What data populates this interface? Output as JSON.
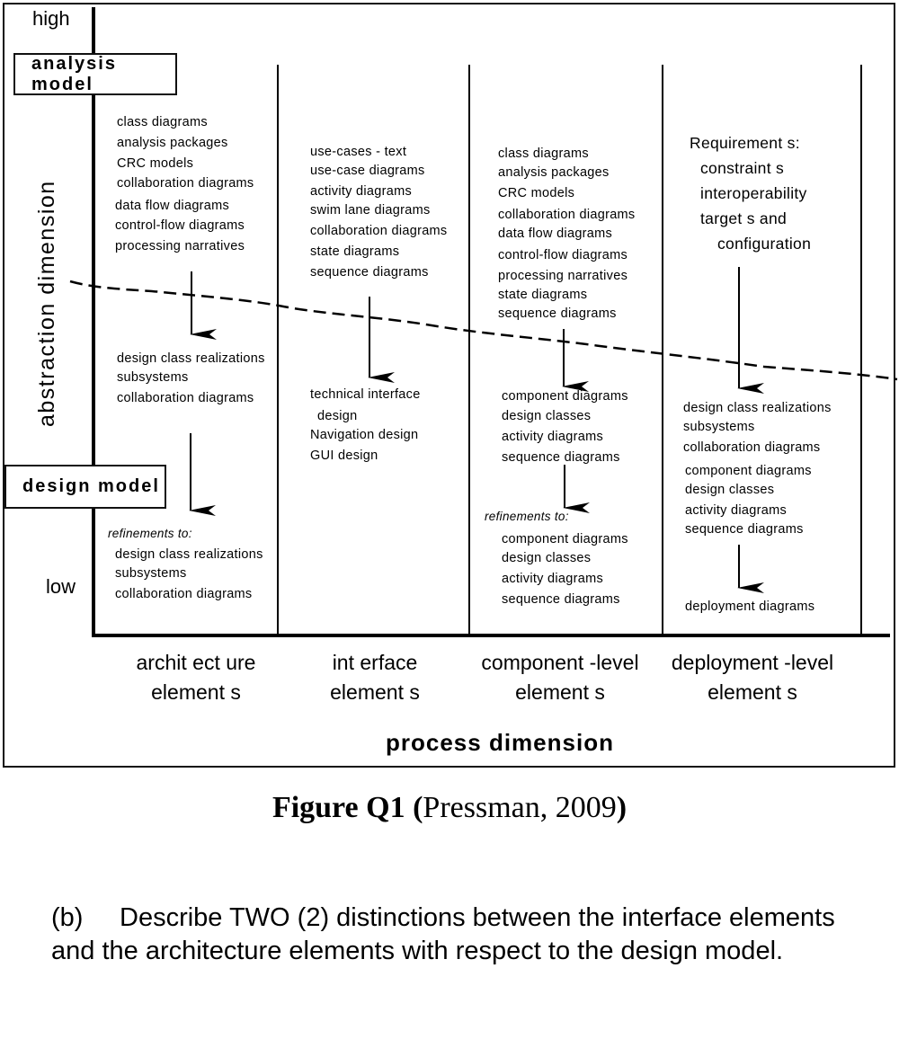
{
  "figure": {
    "axes": {
      "y_high": "high",
      "y_low": "low",
      "y_title": "abstraction dimension",
      "x_title": "process dimension"
    },
    "models": {
      "analysis": "analysis model",
      "design": "design model"
    },
    "columns": [
      {
        "title_line1": "archit ect ure",
        "title_line2": "element s",
        "analysis_items": [
          "class diagrams",
          "analysis packages",
          "CRC models",
          "collaboration diagrams",
          "data flow diagrams",
          "control-flow diagrams",
          "processing narratives"
        ],
        "design_items": [
          "design class realizations",
          "subsystems",
          "collaboration diagrams"
        ],
        "refinements_label": "refinements to:",
        "refinement_items": [
          "design class realizations",
          "subsystems",
          "collaboration diagrams"
        ]
      },
      {
        "title_line1": "int erface",
        "title_line2": "element s",
        "analysis_items": [
          "use-cases - text",
          "use-case diagrams",
          "activity diagrams",
          "swim lane diagrams",
          "collaboration diagrams",
          "state diagrams",
          "sequence diagrams"
        ],
        "design_items": [
          "technical interface",
          "design",
          "Navigation design",
          "GUI design"
        ]
      },
      {
        "title_line1": "component -level",
        "title_line2": "element s",
        "analysis_items": [
          "class diagrams",
          "analysis packages",
          "CRC models",
          "collaboration diagrams",
          "data flow diagrams",
          "control-flow diagrams",
          "processing narratives",
          "state diagrams",
          "sequence diagrams"
        ],
        "design_items": [
          "component diagrams",
          "design classes",
          "activity diagrams",
          "sequence diagrams"
        ],
        "refinements_label": "refinements to:",
        "refinement_items": [
          "component diagrams",
          "design classes",
          "activity diagrams",
          "sequence diagrams"
        ]
      },
      {
        "title_line1": "deployment -level",
        "title_line2": "element s",
        "analysis_items": [
          "Requirement s:",
          "constraint s",
          "interoperability",
          "target s and",
          "configuration"
        ],
        "design_items": [
          "design class realizations",
          "subsystems",
          "collaboration diagrams",
          "component diagrams",
          "design classes",
          "activity diagrams",
          "sequence diagrams"
        ],
        "final_items": [
          "deployment diagrams"
        ]
      }
    ]
  },
  "caption": {
    "label": "Figure Q1",
    "open": "(",
    "source": "Pressman, 2009",
    "close": ")"
  },
  "question": {
    "number": "(b)",
    "text": "Describe TWO (2) distinctions between the interface elements and the architecture elements with respect to the design model."
  }
}
